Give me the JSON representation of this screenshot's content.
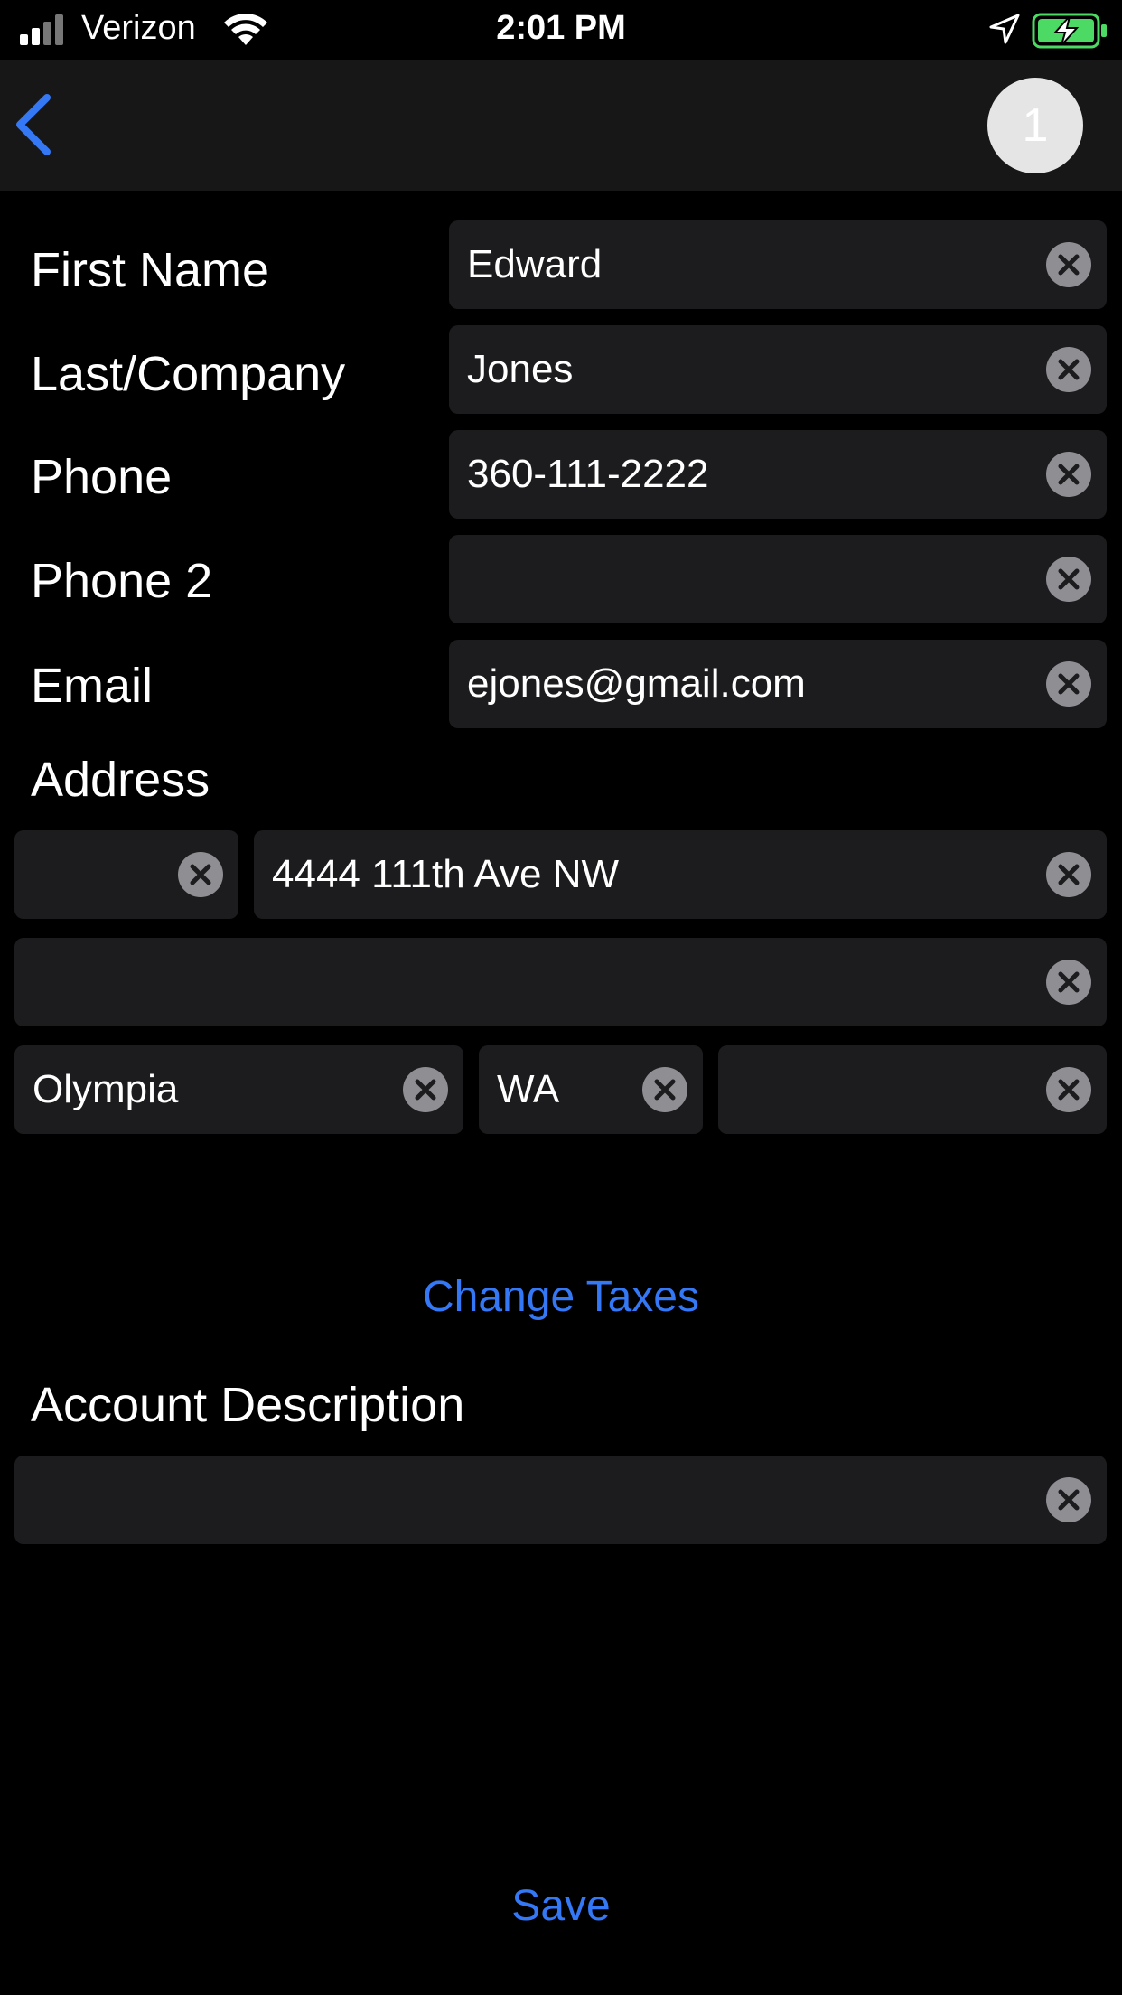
{
  "status_bar": {
    "carrier": "Verizon",
    "time": "2:01 PM"
  },
  "nav": {
    "badge": "1"
  },
  "form": {
    "first_name_label": "First Name",
    "first_name": "Edward",
    "last_label": "Last/Company",
    "last": "Jones",
    "phone_label": "Phone",
    "phone": "360-111-2222",
    "phone2_label": "Phone 2",
    "phone2": "",
    "email_label": "Email",
    "email": "ejones@gmail.com",
    "address_label": "Address",
    "address_number": "",
    "address_street": "4444 111th Ave NW",
    "address_line2": "",
    "city": "Olympia",
    "state": "WA",
    "zip": "",
    "change_taxes": "Change Taxes",
    "account_description_label": "Account Description",
    "account_description": "",
    "save": "Save"
  },
  "colors": {
    "accent": "#3478f6",
    "background": "#000000",
    "field_background": "#1c1c1e",
    "navbar": "#171717"
  }
}
